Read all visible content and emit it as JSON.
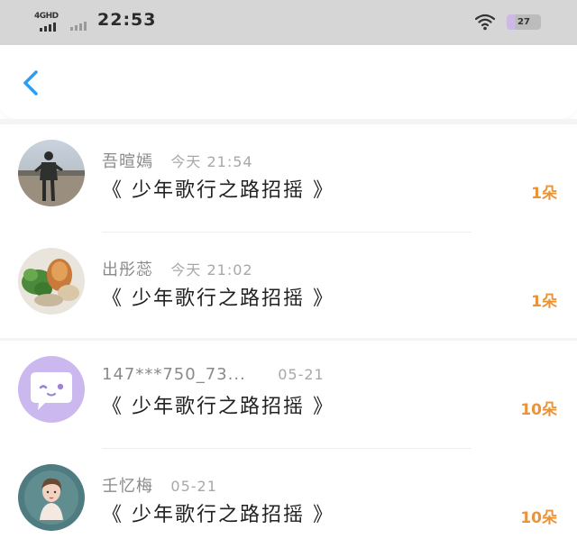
{
  "status_bar": {
    "network": "4GHD",
    "time": "22:53",
    "battery": "27",
    "icons": [
      "signal-icon",
      "signal-secondary-icon",
      "wifi-icon",
      "battery-icon"
    ]
  },
  "header": {
    "back_icon": "chevron-left-icon",
    "accent_color": "#2a9df4"
  },
  "colors": {
    "count": "#e9933a",
    "title": "#222222",
    "meta": "#8a8a8a",
    "status_bar_bg": "#d6d6d6"
  },
  "items": [
    {
      "nickname": "吾暄嫣",
      "time": "今天 21:54",
      "title": "《 少年歌行之路招摇 》",
      "count": "1朵"
    },
    {
      "nickname": "出彤蕊",
      "time": "今天 21:02",
      "title": "《 少年歌行之路招摇 》",
      "count": "1朵"
    },
    {
      "nickname": "147***750_73...",
      "time": "05-21",
      "title": "《 少年歌行之路招摇 》",
      "count": "10朵"
    },
    {
      "nickname": "壬忆梅",
      "time": "05-21",
      "title": "《 少年歌行之路招摇 》",
      "count": "10朵"
    }
  ]
}
